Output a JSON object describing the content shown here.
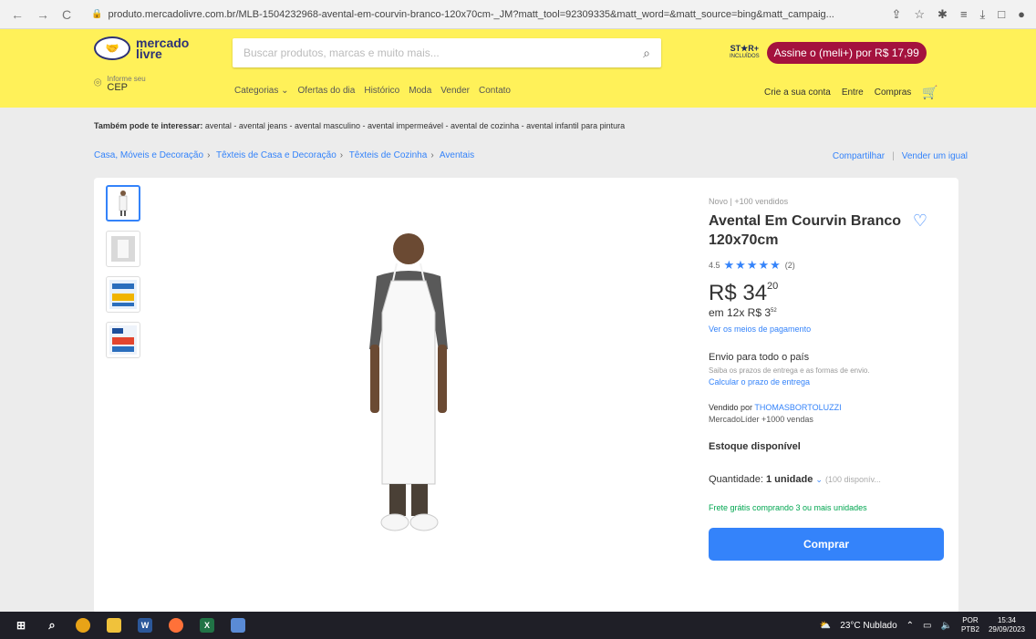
{
  "browser": {
    "url": "produto.mercadolivre.com.br/MLB-1504232968-avental-em-courvin-branco-120x70cm-_JM?matt_tool=92309335&matt_word=&matt_source=bing&matt_campaig..."
  },
  "header": {
    "logo_text_1": "mercado",
    "logo_text_2": "livre",
    "search_placeholder": "Buscar produtos, marcas e muito mais...",
    "disney_label": "ST★R+",
    "disney_sub": "INCLUÍDOS",
    "assine_label": "Assine o (meli+) por R$ 17,99",
    "cep_small": "Informe seu",
    "cep_big": "CEP",
    "menu": [
      "Categorias ⌄",
      "Ofertas do dia",
      "Histórico",
      "Moda",
      "Vender",
      "Contato"
    ],
    "user_menu": [
      "Crie a sua conta",
      "Entre",
      "Compras"
    ]
  },
  "interest": {
    "label": "Também pode te interessar:",
    "items": "avental - avental jeans - avental masculino - avental impermeável - avental de cozinha - avental infantil para pintura"
  },
  "breadcrumb": [
    "Casa, Móveis e Decoração",
    "Têxteis de Casa e Decoração",
    "Têxteis de Cozinha",
    "Aventais"
  ],
  "share": {
    "share_label": "Compartilhar",
    "sell_label": "Vender um igual"
  },
  "product": {
    "condition": "Novo  |  +100 vendidos",
    "title": "Avental Em Courvin Branco 120x70cm",
    "rating_value": "4.5",
    "rating_count": "(2)",
    "price_int": "R$ 34",
    "price_cents": "20",
    "installments": "em 12x R$ 3",
    "installments_cents": "52",
    "payment_link": "Ver os meios de pagamento",
    "shipping_title": "Envio para todo o país",
    "shipping_sub": "Saiba os prazos de entrega e as formas de envio.",
    "shipping_link": "Calcular o prazo de entrega",
    "seller_prefix": "Vendido por",
    "seller_name": "THOMASBORTOLUZZI",
    "seller_info": "MercadoLíder  +1000 vendas",
    "stock": "Estoque disponível",
    "qty_label": "Quantidade:",
    "qty_value": "1 unidade",
    "qty_available": "(100 disponív...",
    "free_shipping": "Frete grátis comprando 3 ou mais unidades",
    "buy_label": "Comprar"
  },
  "taskbar": {
    "weather": "23°C  Nublado",
    "lang_1": "POR",
    "lang_2": "PTB2",
    "time": "15:34",
    "date": "29/09/2023"
  },
  "colors": {
    "ml_yellow": "#fff159",
    "ml_blue": "#3483fa",
    "free_green": "#00a650",
    "meli_red": "#a4123e"
  }
}
